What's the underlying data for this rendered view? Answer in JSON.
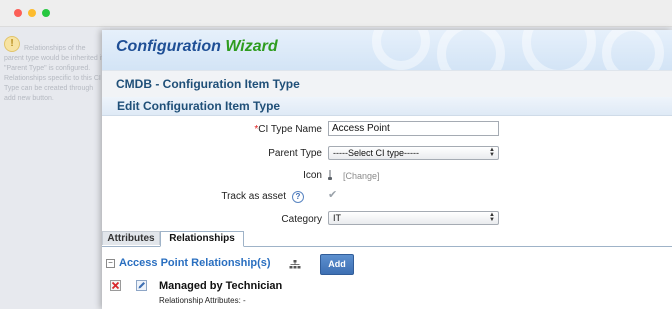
{
  "window": {
    "traffic_lights": [
      "close",
      "minimize",
      "maximize"
    ]
  },
  "background_hint": {
    "text": "Relationships of the parent type would be inherited if \"Parent Type\" is configured. Relationships specific to this CI Type can be created through add new button."
  },
  "dialog": {
    "title_part1": "Configuration",
    "title_part2": "Wizard",
    "section_title": "CMDB - Configuration Item Type",
    "subsection_title": "Edit Configuration Item Type",
    "form": {
      "required_marker": "*",
      "ci_type_name_label": "CI Type Name",
      "ci_type_name_value": "Access Point",
      "parent_type_label": "Parent Type",
      "parent_type_value": "-----Select CI type-----",
      "icon_label": "Icon",
      "icon_change_label": "[Change]",
      "track_as_asset_label": "Track as asset",
      "track_as_asset_checked": true,
      "category_label": "Category",
      "category_value": "IT"
    },
    "tabs": [
      {
        "label": "Attributes",
        "active": false
      },
      {
        "label": "Relationships",
        "active": true
      }
    ],
    "relationships": {
      "heading": "Access Point Relationship(s)",
      "add_label": "Add",
      "items": [
        {
          "name": "Managed by Technician",
          "attributes_text": "Relationship Attributes: -"
        }
      ]
    }
  },
  "colors": {
    "title_blue": "#1f4f96",
    "title_green": "#2e9c1f",
    "add_button": "#4a7fc1",
    "link_blue": "#2a6fc0"
  }
}
